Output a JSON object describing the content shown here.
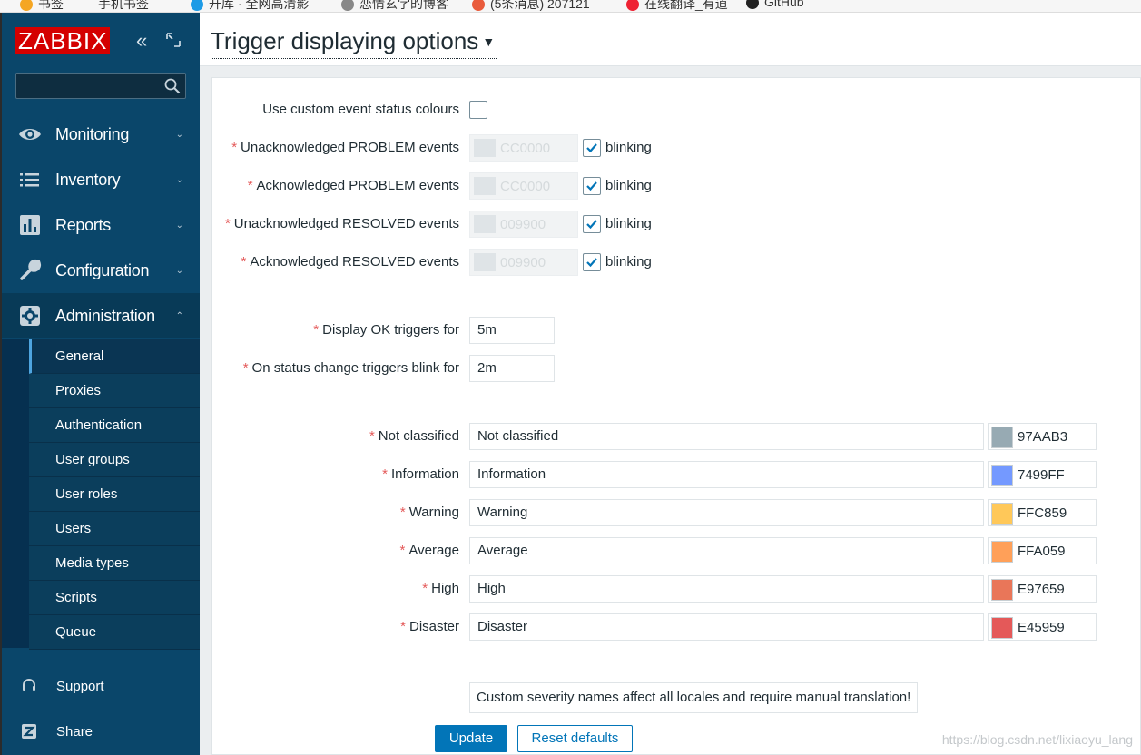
{
  "bookmarks": [
    "书签",
    "手机书签",
    "开库 · 全网高清影",
    "恋情玄学的博客",
    "(5条消息) 207121",
    "在线翻译_有道",
    "GitHub"
  ],
  "logo": "ZABBIX",
  "sidebar": {
    "search_placeholder": "",
    "menu": [
      {
        "label": "Monitoring",
        "icon": "eye-icon",
        "expanded": false
      },
      {
        "label": "Inventory",
        "icon": "list-icon",
        "expanded": false
      },
      {
        "label": "Reports",
        "icon": "bar-chart-icon",
        "expanded": false
      },
      {
        "label": "Configuration",
        "icon": "wrench-icon",
        "expanded": false
      },
      {
        "label": "Administration",
        "icon": "gear-icon",
        "expanded": true
      }
    ],
    "submenu": [
      "General",
      "Proxies",
      "Authentication",
      "User groups",
      "User roles",
      "Users",
      "Media types",
      "Scripts",
      "Queue"
    ],
    "current_submenu": "General",
    "bottom": [
      {
        "label": "Support",
        "icon": "headset-icon"
      },
      {
        "label": "Share",
        "icon": "share-z-icon"
      }
    ]
  },
  "header": {
    "title": "Trigger displaying options"
  },
  "form": {
    "custom_colours_label": "Use custom event status colours",
    "custom_colours_checked": false,
    "event_rows": [
      {
        "label": "Unacknowledged PROBLEM events",
        "color": "CC0000",
        "blinking_label": "blinking",
        "blinking": true
      },
      {
        "label": "Acknowledged PROBLEM events",
        "color": "CC0000",
        "blinking_label": "blinking",
        "blinking": true
      },
      {
        "label": "Unacknowledged RESOLVED events",
        "color": "009900",
        "blinking_label": "blinking",
        "blinking": true
      },
      {
        "label": "Acknowledged RESOLVED events",
        "color": "009900",
        "blinking_label": "blinking",
        "blinking": true
      }
    ],
    "display_ok_label": "Display OK triggers for",
    "display_ok_value": "5m",
    "blink_label": "On status change triggers blink for",
    "blink_value": "2m",
    "severities": [
      {
        "label": "Not classified",
        "name": "Not classified",
        "color": "97AAB3"
      },
      {
        "label": "Information",
        "name": "Information",
        "color": "7499FF"
      },
      {
        "label": "Warning",
        "name": "Warning",
        "color": "FFC859"
      },
      {
        "label": "Average",
        "name": "Average",
        "color": "FFA059"
      },
      {
        "label": "High",
        "name": "High",
        "color": "E97659"
      },
      {
        "label": "Disaster",
        "name": "Disaster",
        "color": "E45959"
      }
    ],
    "notice": "Custom severity names affect all locales and require manual translation!",
    "update_label": "Update",
    "reset_label": "Reset defaults"
  },
  "watermark": "https://blog.csdn.net/lixiaoyu_lang"
}
